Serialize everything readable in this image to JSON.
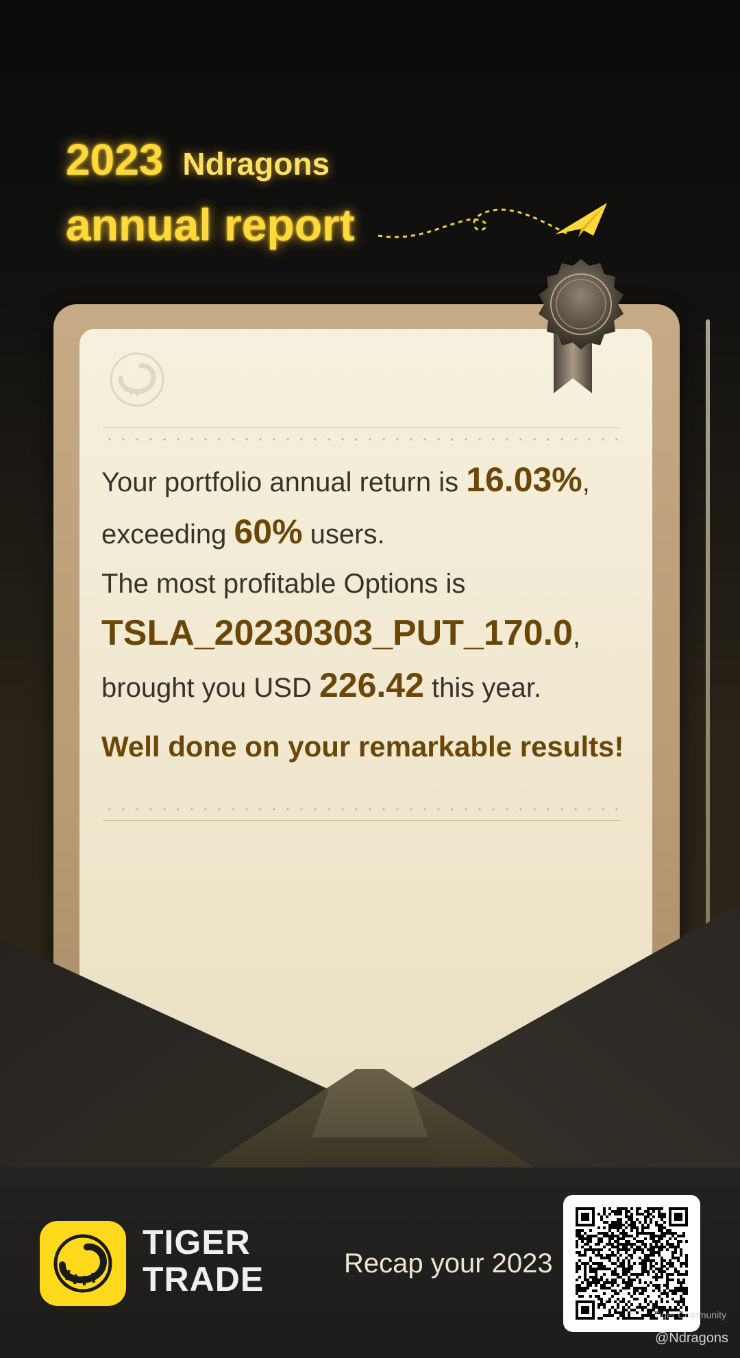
{
  "header": {
    "year": "2023",
    "username": "Ndragons",
    "subtitle": "annual report"
  },
  "card": {
    "segments": {
      "return_prefix": "Your portfolio annual return is ",
      "return_value": "16.03%",
      "return_suffix": ",",
      "exceed_prefix": "exceeding ",
      "exceed_value": "60%",
      "exceed_suffix": " users.",
      "options_line": "The most profitable Options is",
      "option_name": "TSLA_20230303_PUT_170.0",
      "option_suffix": ",",
      "profit_prefix": "brought you USD ",
      "profit_value": "226.42",
      "profit_suffix": " this year.",
      "congrats": "Well done on your remarkable results!"
    }
  },
  "footer": {
    "brand_line1": "TIGER",
    "brand_line2": "TRADE",
    "recap_text": "Recap your 2023",
    "community_watermark": "Tiger Community",
    "handle": "@Ndragons"
  },
  "colors": {
    "glow_yellow": "#ffd93a",
    "brand_yellow": "#ffd91c",
    "highlight_brown": "#6b4607",
    "paper": "#f3ecd6"
  },
  "icons": {
    "plane": "paper-plane-icon",
    "medal": "medal-ribbon-icon",
    "logo": "tiger-logo-icon",
    "qr": "qr-code-icon"
  }
}
